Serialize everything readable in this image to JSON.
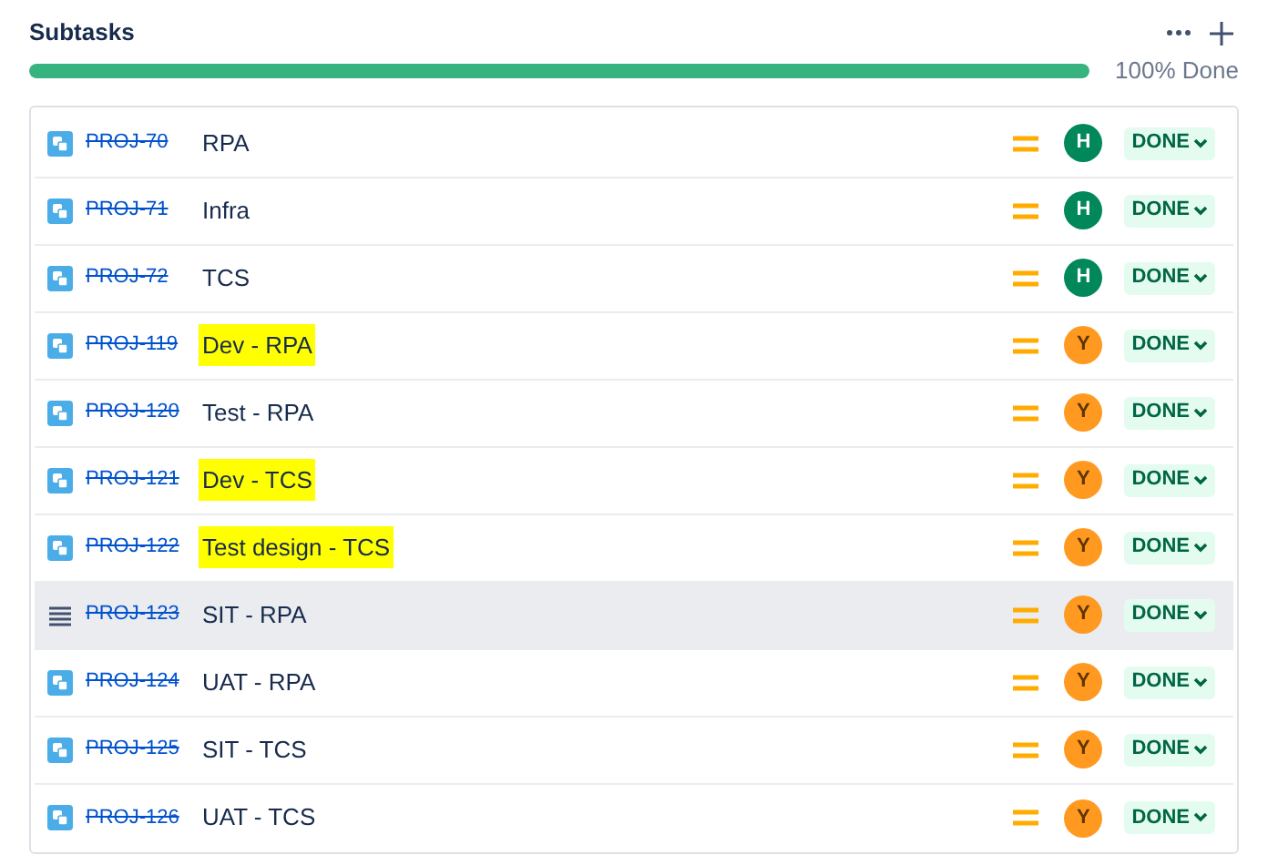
{
  "header": {
    "title": "Subtasks",
    "progress": {
      "level": 1,
      "label": "100% Done"
    }
  },
  "subtasks": [
    {
      "key": "PROJ-70",
      "summary": "RPA",
      "highlighted": false,
      "hovered": false,
      "avatar": {
        "initial": "H",
        "color": "#00875a"
      },
      "status": "DONE"
    },
    {
      "key": "PROJ-71",
      "summary": "Infra",
      "highlighted": false,
      "hovered": false,
      "avatar": {
        "initial": "H",
        "color": "#00875a"
      },
      "status": "DONE"
    },
    {
      "key": "PROJ-72",
      "summary": "TCS",
      "highlighted": false,
      "hovered": false,
      "avatar": {
        "initial": "H",
        "color": "#00875a"
      },
      "status": "DONE"
    },
    {
      "key": "PROJ-119",
      "summary": "Dev - RPA",
      "highlighted": true,
      "hovered": false,
      "avatar": {
        "initial": "Y",
        "color": "#ff991f"
      },
      "status": "DONE"
    },
    {
      "key": "PROJ-120",
      "summary": "Test - RPA",
      "highlighted": false,
      "hovered": false,
      "avatar": {
        "initial": "Y",
        "color": "#ff991f"
      },
      "status": "DONE"
    },
    {
      "key": "PROJ-121",
      "summary": "Dev - TCS",
      "highlighted": true,
      "hovered": false,
      "avatar": {
        "initial": "Y",
        "color": "#ff991f"
      },
      "status": "DONE"
    },
    {
      "key": "PROJ-122",
      "summary": "Test design - TCS",
      "highlighted": true,
      "hovered": false,
      "avatar": {
        "initial": "Y",
        "color": "#ff991f"
      },
      "status": "DONE"
    },
    {
      "key": "PROJ-123",
      "summary": "SIT - RPA",
      "highlighted": false,
      "hovered": true,
      "avatar": {
        "initial": "Y",
        "color": "#ff991f"
      },
      "status": "DONE"
    },
    {
      "key": "PROJ-124",
      "summary": "UAT - RPA",
      "highlighted": false,
      "hovered": false,
      "avatar": {
        "initial": "Y",
        "color": "#ff991f"
      },
      "status": "DONE"
    },
    {
      "key": "PROJ-125",
      "summary": "SIT - TCS",
      "highlighted": false,
      "hovered": false,
      "avatar": {
        "initial": "Y",
        "color": "#ff991f"
      },
      "status": "DONE"
    },
    {
      "key": "PROJ-126",
      "summary": "UAT - TCS",
      "highlighted": false,
      "hovered": false,
      "avatar": {
        "initial": "Y",
        "color": "#ff991f"
      },
      "status": "DONE"
    }
  ]
}
